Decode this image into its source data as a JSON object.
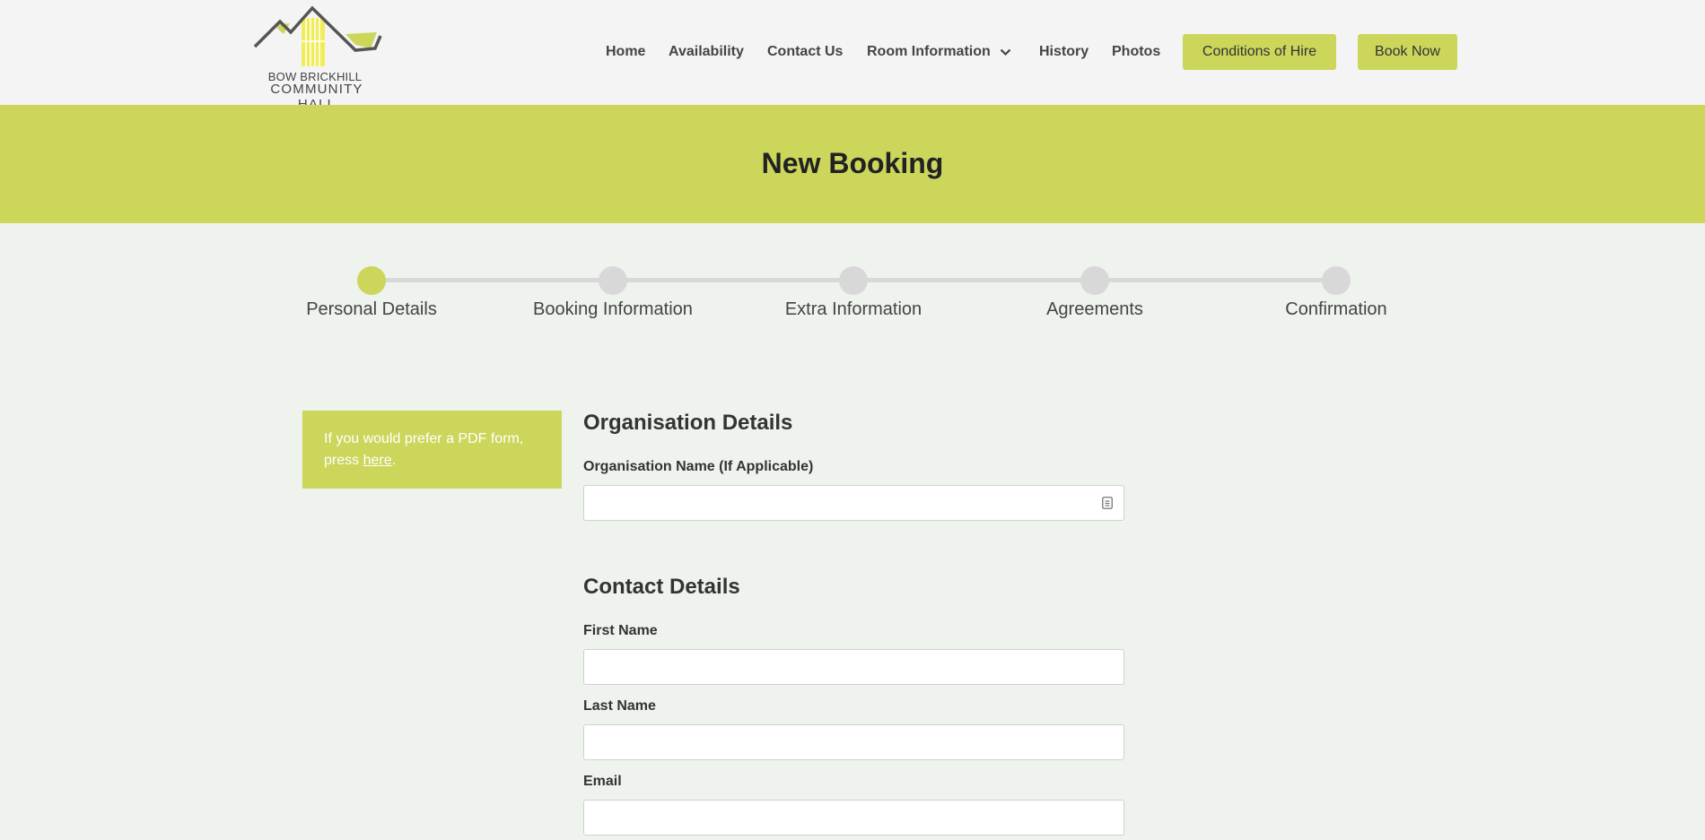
{
  "brand": {
    "line1": "BOW BRICKHILL",
    "line2": "COMMUNITY HALL"
  },
  "nav": {
    "home": "Home",
    "availability": "Availability",
    "contact": "Contact Us",
    "room_info": "Room Information",
    "history": "History",
    "photos": "Photos",
    "conditions": "Conditions of Hire",
    "book_now": "Book Now"
  },
  "banner": {
    "title": "New Booking"
  },
  "steps": [
    {
      "label": "Personal Details",
      "active": true
    },
    {
      "label": "Booking Information",
      "active": false
    },
    {
      "label": "Extra Information",
      "active": false
    },
    {
      "label": "Agreements",
      "active": false
    },
    {
      "label": "Confirmation",
      "active": false
    }
  ],
  "pdf_note": {
    "text_before": "If you would prefer a PDF form, press ",
    "link": "here",
    "text_after": "."
  },
  "organisation": {
    "title": "Organisation Details",
    "name_label": "Organisation Name (If Applicable)",
    "name_value": ""
  },
  "contact": {
    "title": "Contact Details",
    "first_name_label": "First Name",
    "first_name_value": "",
    "last_name_label": "Last Name",
    "last_name_value": "",
    "email_label": "Email",
    "email_value": ""
  },
  "colors": {
    "accent": "#cbd65b",
    "page_bg": "#eef3ee",
    "header_bg": "#f4f4f4",
    "step_inactive": "#d8d8d8"
  }
}
